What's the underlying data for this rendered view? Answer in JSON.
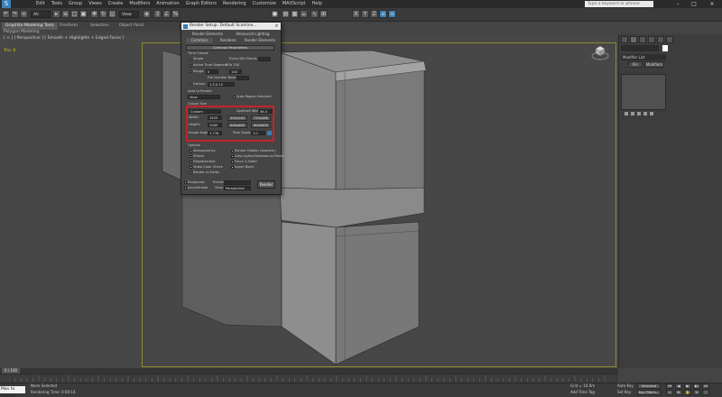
{
  "app": {
    "logo_letter": "S",
    "menu": [
      "Edit",
      "Tools",
      "Group",
      "Views",
      "Create",
      "Modifiers",
      "Animation",
      "Graph Editors",
      "Rendering",
      "Customize",
      "MAXScript",
      "Help"
    ],
    "search_placeholder": "Type a keyword or phrase"
  },
  "toolbar": {
    "undo_icon": "undo-icon",
    "redo_icon": "redo-icon",
    "selection_filter": "All",
    "coordinate_system": "View"
  },
  "ribbon": {
    "tabs": [
      "Graphite Modeling Tools",
      "Freeform",
      "Selection",
      "Object Paint"
    ],
    "active_tab": "Graphite Modeling Tools",
    "sub_label": "Polygon Modeling"
  },
  "viewport": {
    "label": "[ + ] [ Perspective ] [ Smooth + Highlights + Edged Faces ]",
    "coords": "Tris: 0"
  },
  "command_panel": {
    "object_name": "",
    "modifier_list": "Modifier List",
    "btn_pin": "Pin",
    "btn_rollup": "Modifiers"
  },
  "render_dialog": {
    "title": "Render Setup: Default Scanline...",
    "close": "×",
    "tabs_row1": [
      "Render Elements",
      "Advanced Lighting"
    ],
    "tabs_row2": [
      "Common",
      "Renderer",
      "Render Elements"
    ],
    "section_title": "Common Parameters",
    "time_output": "Time Output",
    "single": "Single",
    "every_nth": "Every Nth Frame:",
    "active_segment": "Active Time Segment:",
    "active_segment_value": "0 To 100",
    "range": "Range:",
    "range_from": "0",
    "range_to": "100",
    "file_number_base": "File Number Base:",
    "frames": "Frames",
    "frames_value": "1,3,5-12",
    "area_to_render": "Area to Render",
    "area_value": "View",
    "auto_region": "Auto Region Selected",
    "output_size": "Output Size",
    "output_preset": "Custom",
    "aperture_label": "Aperture Width(mm):",
    "aperture_value": "36.0",
    "width_label": "Width:",
    "width_value": "1920",
    "height_label": "Height:",
    "height_value": "1080",
    "preset_buttons": [
      "320x240",
      "720x486",
      "640x480",
      "800x600"
    ],
    "image_aspect_label": "Image Aspect:",
    "image_aspect_value": "1.778",
    "pixel_aspect_label": "Pixel Aspect:",
    "pixel_aspect_value": "1.0",
    "options_title": "Options",
    "options": [
      "Atmospherics",
      "Render Hidden Geometry",
      "Effects",
      "Area Lights/Shadows as Points",
      "Displacement",
      "Force 2-Sided",
      "Video Color Check",
      "Super Black",
      "Render to Fields"
    ],
    "footer_mode": "Production",
    "footer_preset": "Preset:",
    "footer_view": "View:",
    "footer_view_value": "Perspective",
    "footer_active": "ActiveShade",
    "render_button": "Render"
  },
  "timeline": {
    "slider_label": "0 / 100"
  },
  "status": {
    "maxscript_label": "Max to Physca",
    "selection": "None Selected",
    "rendering_time": "Rendering Time: 0:00:14",
    "grid": "Grid = 10.0m",
    "add_time_tag": "Add Time Tag",
    "auto_key": "Auto Key",
    "auto_key_value": "Selected",
    "set_key": "Set Key",
    "key_filters": "Key Filters..."
  }
}
